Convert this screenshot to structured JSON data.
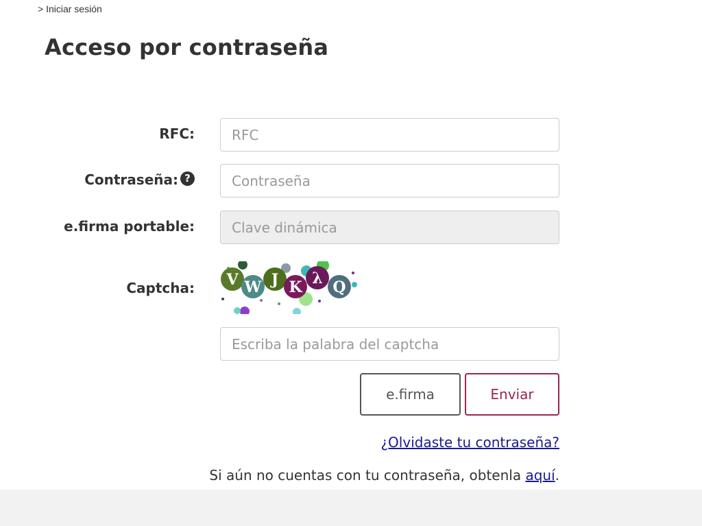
{
  "breadcrumb": {
    "text": "> Iniciar sesión"
  },
  "page": {
    "title": "Acceso por contraseña"
  },
  "form": {
    "rfc": {
      "label": "RFC:",
      "placeholder": "RFC"
    },
    "password": {
      "label": "Contraseña:",
      "placeholder": "Contraseña",
      "help_icon": "?"
    },
    "efirma_portable": {
      "label": "e.firma portable:",
      "placeholder": "Clave dinámica"
    },
    "captcha": {
      "label": "Captcha:",
      "placeholder": "Escriba la palabra del captcha",
      "letters": [
        "V",
        "W",
        "J",
        "K",
        "λ",
        "Q"
      ]
    }
  },
  "buttons": {
    "efirma": "e.firma",
    "enviar": "Enviar"
  },
  "links": {
    "forgot": "¿Olvidaste tu contraseña?",
    "signup_text": "Si aún no cuentas con tu contraseña, obtenla ",
    "signup_link": "aquí",
    "signup_end": "."
  },
  "colors": {
    "accent": "#9d2449",
    "link": "#1a1a8c",
    "text": "#333333"
  }
}
